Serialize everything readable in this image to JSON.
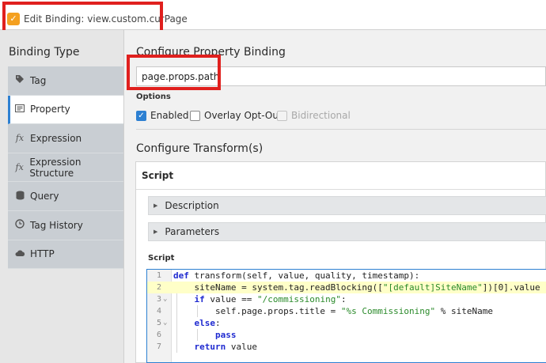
{
  "window": {
    "title": "Edit Binding: view.custom.curPage"
  },
  "sidebar": {
    "heading": "Binding Type",
    "items": [
      {
        "label": "Tag",
        "icon": "tag-icon"
      },
      {
        "label": "Property",
        "icon": "property-icon",
        "active": true
      },
      {
        "label": "Expression",
        "icon": "fx-icon"
      },
      {
        "label": "Expression Structure",
        "icon": "fx-icon"
      },
      {
        "label": "Query",
        "icon": "database-icon"
      },
      {
        "label": "Tag History",
        "icon": "clock-icon"
      },
      {
        "label": "HTTP",
        "icon": "cloud-icon"
      }
    ]
  },
  "main": {
    "configure_title": "Configure Property Binding",
    "path_value": "page.props.path",
    "options_label": "Options",
    "options": {
      "enabled": {
        "label": "Enabled",
        "checked": true
      },
      "overlay": {
        "label": "Overlay Opt-Out",
        "checked": false
      },
      "bidirectional": {
        "label": "Bidirectional",
        "checked": false,
        "disabled": true
      }
    },
    "transform_title": "Configure Transform(s)",
    "script": {
      "header": "Script",
      "description_label": "Description",
      "parameters_label": "Parameters",
      "script_label": "Script",
      "lines": [
        "def transform(self, value, quality, timestamp):",
        "    siteName = system.tag.readBlocking([\"[default]SiteName\"])[0].value",
        "    if value == \"/commissioning\":",
        "        self.page.props.title = \"%s Commissioning\" % siteName",
        "    else:",
        "        pass",
        "    return value"
      ],
      "line_numbers": [
        "1",
        "2",
        "3",
        "4",
        "5",
        "6",
        "7"
      ]
    }
  },
  "colors": {
    "accent": "#2d80d2",
    "highlight": "#e0201e",
    "current_line": "#ffffc8"
  }
}
